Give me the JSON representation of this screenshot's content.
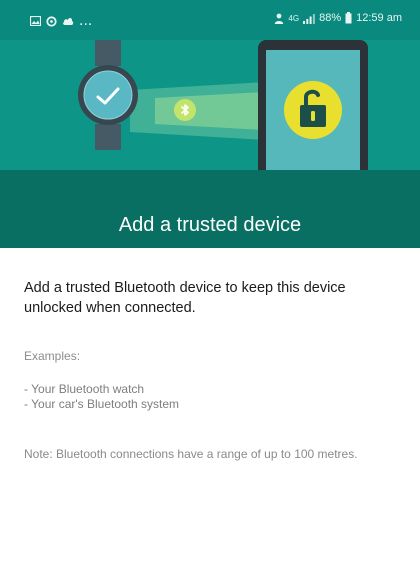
{
  "status_bar": {
    "left_icons": [
      "image-icon",
      "sync-icon",
      "cloud-icon"
    ],
    "overflow": "...",
    "right_icons": [
      "person-icon",
      "signal-icon",
      "battery-icon"
    ],
    "network": "4G",
    "battery_percent": "88%",
    "time": "12:59 am"
  },
  "hero": {
    "illustration": [
      "smartwatch-icon",
      "bluetooth-icon",
      "phone-icon",
      "unlocked-padlock-icon"
    ],
    "title": "Add a trusted device"
  },
  "content": {
    "intro": "Add a trusted Bluetooth device to keep this device unlocked when connected.",
    "examples_label": "Examples:",
    "examples": [
      "- Your Bluetooth watch",
      "- Your car's Bluetooth system"
    ],
    "note": "Note: Bluetooth connections have a range of up to 100 metres."
  },
  "colors": {
    "status_bar": "#0a8a7e",
    "hero_bg": "#0d9688",
    "title_band": "#096f63",
    "lock_yellow": "#e9df2f",
    "accent_green": "#a7e07c"
  }
}
